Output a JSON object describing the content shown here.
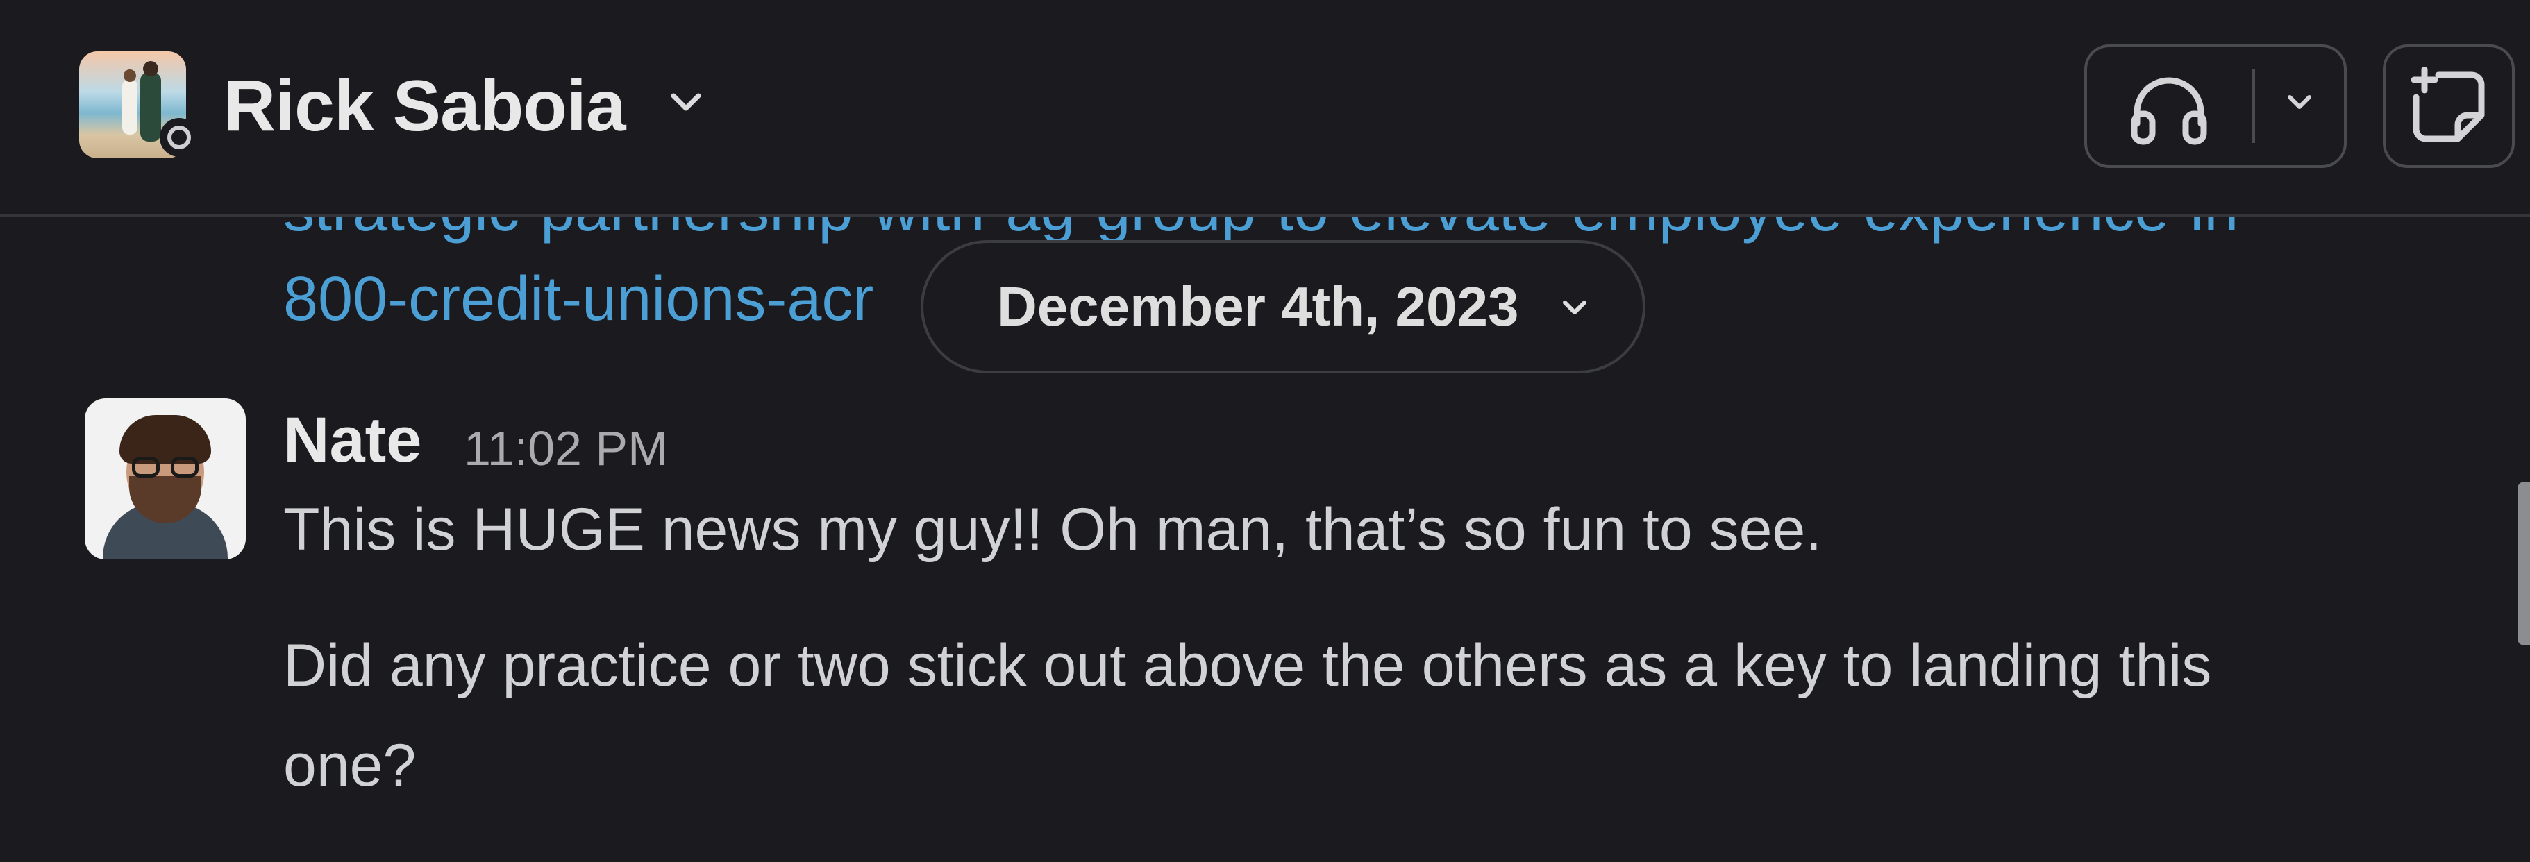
{
  "header": {
    "channel_name": "Rick Saboia",
    "avatar_alt": "Rick Saboia profile photo",
    "presence": "away",
    "icons": {
      "channel_menu": "chevron-down-icon",
      "huddle": "headphones-icon",
      "huddle_options": "chevron-down-icon",
      "new_canvas": "new-canvas-icon"
    }
  },
  "feed": {
    "link_partial_top": "strategic-partnership-with-ag-group-to-elevate-employee-experience-in-",
    "link_partial": "800-credit-unions-acr",
    "date_divider": {
      "label": "December 4th, 2023"
    },
    "message": {
      "author": "Nate",
      "time": "11:02 PM",
      "lines": [
        "This is HUGE news my guy!! Oh man, that’s so fun to see.",
        "Did any practice or two stick out above the others as a key to landing this",
        "one?"
      ]
    }
  },
  "colors": {
    "background": "#1b1b1f",
    "link": "#4b9fd5",
    "text": "#d1d2d3",
    "muted": "#ababad",
    "border": "#4a4b50"
  }
}
